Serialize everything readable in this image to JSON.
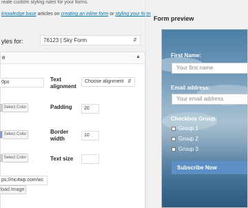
{
  "intro_text": "reate custom styling rules for your forms.",
  "help": {
    "link_knowledge_base": "knowledge base",
    "text_articles_on": " articles on ",
    "link_inline_form": "creating an inline form",
    "text_or": " or ",
    "link_styling": "styling your form"
  },
  "styles_for": {
    "label": "yles for:",
    "selected": "76123 | Sky Form"
  },
  "panel": {
    "title": "e"
  },
  "fields": {
    "width_value": "0px",
    "text_alignment_label": "Text alignment",
    "text_alignment_selected": "Choose alignment",
    "select_color_1": "Select Color",
    "padding_label": "Padding",
    "padding_value": "20",
    "select_color_2": "Select Color",
    "border_width_label": "Border width",
    "border_width_value": "10",
    "select_color_3": "Select Color",
    "text_size_label": "Text size",
    "text_size_value": "",
    "image_url_value": "ps://mc4wp.com/wc",
    "upload_image_label": "load Image"
  },
  "preview": {
    "title": "Form preview",
    "first_name_label": "First Name:",
    "first_name_placeholder": "Your first name",
    "email_label": "Email address:",
    "email_placeholder": "Your email address",
    "checkbox_group_label": "Checkbox Group:",
    "groups": [
      "Group 1",
      "Group 2",
      "Group 3"
    ],
    "submit_label": "Subscribe Now"
  },
  "colors": {
    "link": "#0073aa",
    "accent_blue": "#5d8fc4",
    "swatch_blue": "#3b78e7"
  }
}
